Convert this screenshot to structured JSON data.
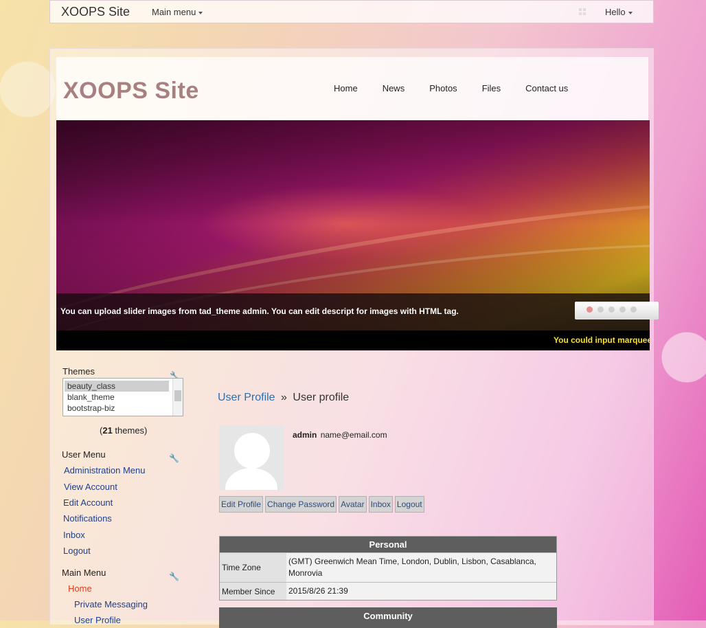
{
  "topbar": {
    "brand": "XOOPS Site",
    "main_menu": "Main menu",
    "hello": "Hello"
  },
  "header": {
    "site_title": "XOOPS Site",
    "nav": [
      "Home",
      "News",
      "Photos",
      "Files",
      "Contact us"
    ]
  },
  "slider": {
    "caption": "You can upload slider images from tad_theme admin. You can edit descript for images with HTML tag.",
    "marquee": "You could input marquee"
  },
  "sidebar": {
    "themes_title": "Themes",
    "themes": [
      "beauty_class",
      "blank_theme",
      "bootstrap-biz",
      "..."
    ],
    "themes_count_prefix": "(",
    "themes_count": "21",
    "themes_count_suffix": " themes)",
    "user_menu_title": "User Menu",
    "user_menu": [
      "Administration Menu",
      "View Account",
      "Edit Account",
      "Notifications",
      "Inbox",
      "Logout"
    ],
    "main_menu_title": "Main Menu",
    "main_menu": [
      "Home",
      "Private Messaging",
      "User Profile"
    ]
  },
  "content": {
    "breadcrumb_link": "User Profile",
    "breadcrumb_sep": "»",
    "breadcrumb_current": "User profile",
    "username": "admin",
    "email": "name@email.com",
    "buttons": [
      "Edit Profile",
      "Change Password",
      "Avatar",
      "Inbox",
      "Logout"
    ],
    "personal": {
      "title": "Personal",
      "time_zone_label": "Time Zone",
      "time_zone_value": "(GMT) Greenwich Mean Time, London, Dublin, Lisbon, Casablanca, Monrovia",
      "member_since_label": "Member Since",
      "member_since_value": "2015/8/26 21:39"
    },
    "community_title": "Community"
  }
}
